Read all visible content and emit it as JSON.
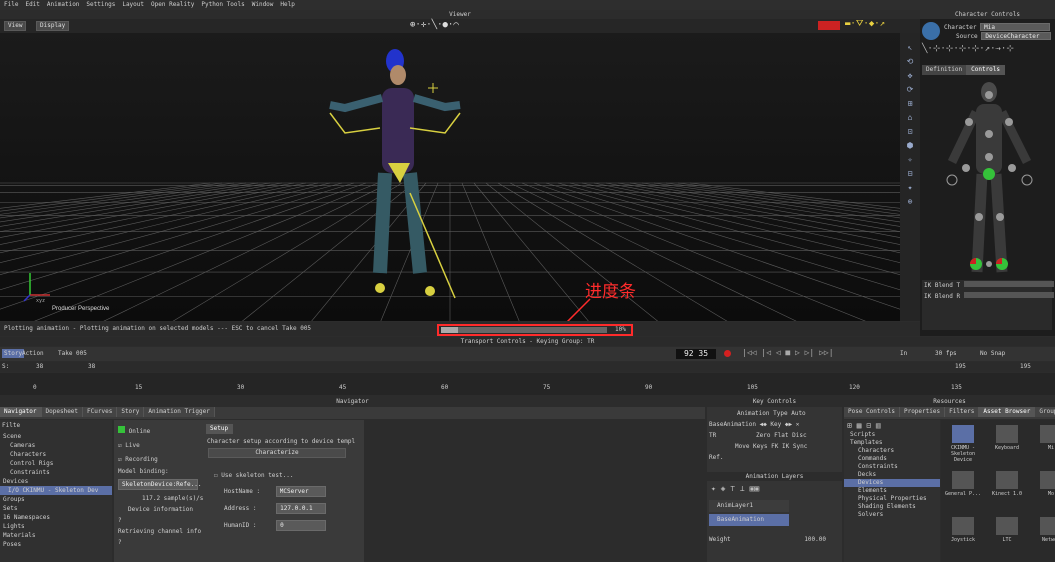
{
  "menu": [
    "File",
    "Edit",
    "Animation",
    "Settings",
    "Layout",
    "Open Reality",
    "Python Tools",
    "Window",
    "Help"
  ],
  "viewer": {
    "title": "Viewer",
    "view_btn": "View",
    "display_btn": "Display",
    "perspective_label": "Producer Perspective",
    "xyz_label": "xyz"
  },
  "status": {
    "message": "Plotting animation - Plotting animation on selected models --- ESC to cancel Take 005",
    "progress_pct": "10%",
    "progress_value": 0.1,
    "annotation": "进度条"
  },
  "character_controls": {
    "title": "Character Controls",
    "character_label": "Character",
    "character_value": "Mia",
    "source_label": "Source",
    "source_value": "DeviceCharacter",
    "tabs": [
      "Definition",
      "Controls"
    ],
    "ik_blend_1": "IK Blend T",
    "ik_blend_2": "IK Blend R"
  },
  "transport": {
    "title": "Transport Controls  -  Keying Group: TR",
    "story": "Story",
    "action": "Action",
    "take": "Take 005",
    "timecode": "92 35",
    "in_label": "In",
    "fps": "30 fps",
    "snap": "No Snap",
    "start": "38",
    "current": "38",
    "frame_value": "195",
    "end": "195",
    "ticks": [
      "0",
      "15",
      "30",
      "45",
      "60",
      "75",
      "90",
      "105",
      "120",
      "135"
    ]
  },
  "navigator": {
    "title": "Navigator",
    "tabs": [
      "Navigator",
      "Dopesheet",
      "FCurves",
      "Story",
      "Animation Trigger"
    ],
    "filter": "Filte",
    "tree": [
      "Scene",
      "Cameras",
      "Characters",
      "Control Rigs",
      "Constraints",
      "Devices",
      "I/O CKINMU - Skeleton Dev",
      "Groups",
      "Sets",
      "16 Namespaces",
      "Lights",
      "Materials",
      "Poses"
    ],
    "online_label": "Online",
    "live_label": "Live",
    "recording_label": "Recording",
    "model_binding": "Model binding:",
    "binding_value": "SkeletonDevice:Refe...",
    "sample_rate": "117.2 sample(s)/s",
    "device_info": "Device information",
    "q1": "?",
    "retrieving": "Retrieving channel info",
    "q2": "?",
    "setup_tab": "Setup",
    "char_setup_text": "Character setup according to device templ",
    "characterize_btn": "Characterize",
    "use_skeleton": "Use skeleton test...",
    "hostname_label": "HostName :",
    "hostname_value": "MCServer",
    "address_label": "Address :",
    "address_value": "127.0.0.1",
    "humanid_label": "HumanID :",
    "humanid_value": "0"
  },
  "key_controls": {
    "title": "Key Controls",
    "animation_label": "Animation",
    "type_label": "Type",
    "type_value": "Auto",
    "base_anim": "BaseAnimation",
    "key_label": "Key",
    "tr": "TR",
    "zero": "Zero",
    "flat": "Flat",
    "disc": "Disc",
    "move_keys": "Move Keys",
    "fk": "FK",
    "ik": "IK",
    "sync": "Sync",
    "ref_label": "Ref.",
    "layers_title": "Animation Layers",
    "layers": [
      "AnimLayer1",
      "BaseAnimation"
    ],
    "weight_label": "Weight",
    "weight_value": "100.00"
  },
  "resources": {
    "title": "Resources",
    "tabs": [
      "Pose Controls",
      "Properties",
      "Filters",
      "Asset Browser",
      "Groups"
    ],
    "tree": [
      "Scripts",
      "Templates",
      "Characters",
      "Commands",
      "Constraints",
      "Decks",
      "Devices",
      "Elements",
      "Physical Properties",
      "Shading Elements",
      "Solvers"
    ],
    "assets": [
      "CKINMU - Skeleton Device",
      "Keyboard",
      "Mi",
      "General P...",
      "Kinect 1.0",
      "Mo",
      "Joystick",
      "LTC",
      "Networ"
    ]
  },
  "colors": {
    "accent": "#35c23a",
    "record": "#d42020",
    "annotation": "#ff2b2b",
    "selection": "#5b6fa6"
  }
}
